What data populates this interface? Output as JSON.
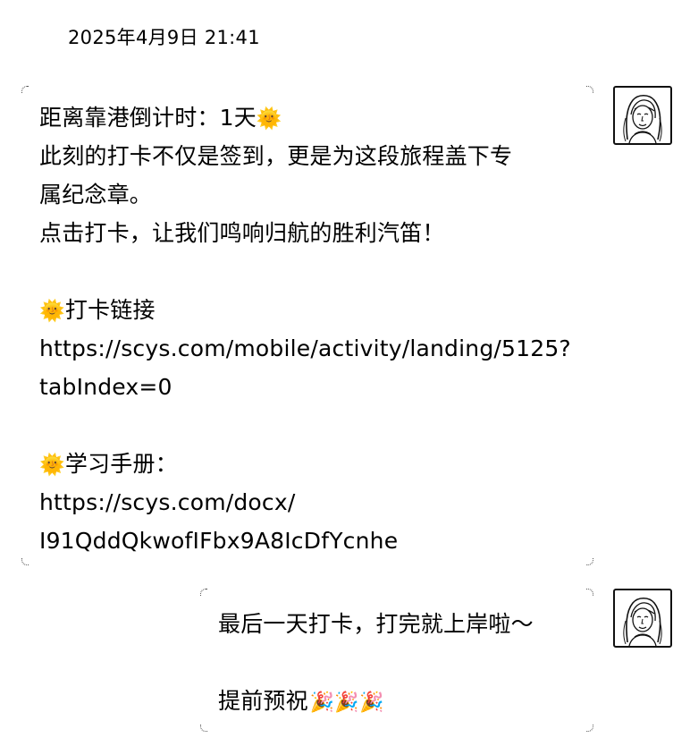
{
  "header": {
    "timestamp": "2025年4月9日 21:41"
  },
  "messages": [
    {
      "sender": "self",
      "avatar_icon": "woman-portrait-icon",
      "lines": [
        {
          "text": "距离靠港倒计时：1天",
          "trailing_icon": "🌞"
        },
        {
          "text": "此刻的打卡不仅是签到，更是为这段旅程盖下专"
        },
        {
          "text": "属纪念章。"
        },
        {
          "text": "点击打卡，让我们鸣响归航的胜利汽笛！"
        },
        {
          "text": ""
        },
        {
          "leading_icon": "🌞",
          "text": "打卡链接"
        },
        {
          "text": "https://scys.com/mobile/activity/landing/5125?"
        },
        {
          "text": "tabIndex=0"
        },
        {
          "text": ""
        },
        {
          "leading_icon": "🌞",
          "text": "学习手册："
        },
        {
          "text": "https://scys.com/docx/"
        },
        {
          "text": "I91QddQkwofIFbx9A8IcDfYcnhe"
        }
      ]
    },
    {
      "sender": "self",
      "avatar_icon": "woman-portrait-icon",
      "lines": [
        {
          "text": "最后一天打卡，打完就上岸啦～"
        },
        {
          "text": ""
        },
        {
          "text": "提前预祝",
          "trailing_icon": "🎉🎉🎉"
        }
      ]
    }
  ]
}
